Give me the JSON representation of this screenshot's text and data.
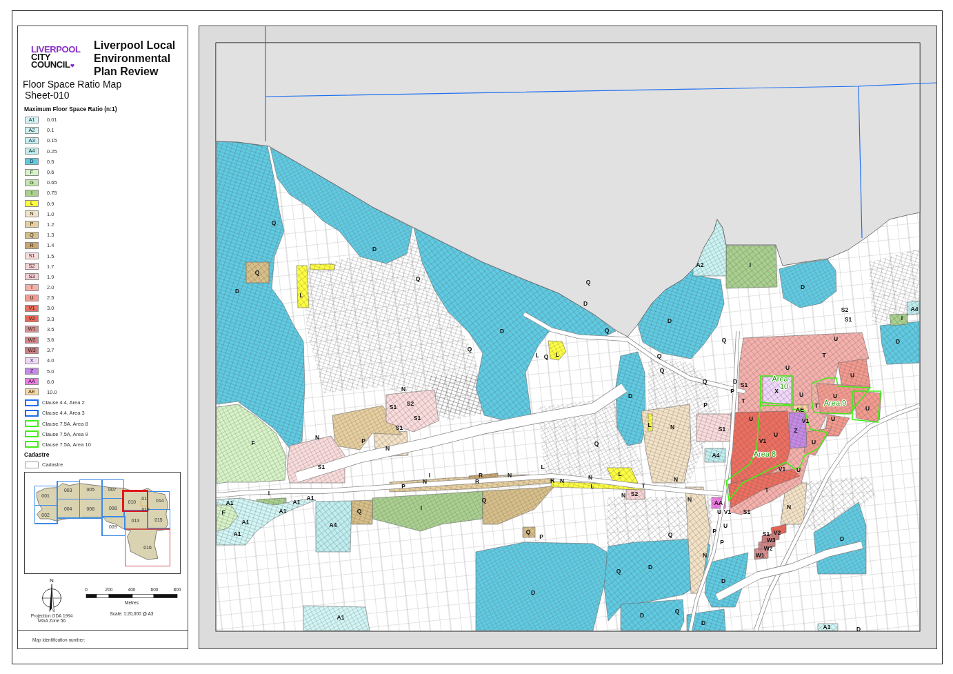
{
  "legend_panel": {
    "logo": {
      "lines": [
        "LIVERPOOL",
        "CITY",
        "COUNCIL"
      ]
    },
    "title": "Liverpool Local Environmental Plan Review",
    "map_title": "Floor Space Ratio Map",
    "sheet": "Sheet-010",
    "fsr_heading": "Maximum Floor Space Ratio (n:1)",
    "fsr_items": [
      {
        "kind": "fill",
        "code": "A1",
        "value": "0.01",
        "color": "#d2f6f6"
      },
      {
        "kind": "fill",
        "code": "A2",
        "value": "0.1",
        "color": "#cbf4f4"
      },
      {
        "kind": "fill",
        "code": "A3",
        "value": "0.15",
        "color": "#c5f1f2"
      },
      {
        "kind": "fill",
        "code": "A4",
        "value": "0.25",
        "color": "#bfeef0"
      },
      {
        "kind": "fill",
        "code": "D",
        "value": "0.5",
        "color": "#5fcbe3"
      },
      {
        "kind": "fill",
        "code": "F",
        "value": "0.6",
        "color": "#d6f4c6"
      },
      {
        "kind": "fill",
        "code": "G",
        "value": "0.65",
        "color": "#c2e6ad"
      },
      {
        "kind": "fill",
        "code": "I",
        "value": "0.75",
        "color": "#a9d08e"
      },
      {
        "kind": "fill",
        "code": "L",
        "value": "0.9",
        "color": "#ffff40"
      },
      {
        "kind": "fill",
        "code": "N",
        "value": "1.0",
        "color": "#f4e2c6"
      },
      {
        "kind": "fill",
        "code": "P",
        "value": "1.2",
        "color": "#e8cf9e"
      },
      {
        "kind": "fill",
        "code": "Q",
        "value": "1.3",
        "color": "#d8bf88"
      },
      {
        "kind": "fill",
        "code": "R",
        "value": "1.4",
        "color": "#caa56f"
      },
      {
        "kind": "fill",
        "code": "S1",
        "value": "1.5",
        "color": "#fbdcdd"
      },
      {
        "kind": "fill",
        "code": "S2",
        "value": "1.7",
        "color": "#f9d4d6"
      },
      {
        "kind": "fill",
        "code": "S3",
        "value": "1.9",
        "color": "#f6cdd0"
      },
      {
        "kind": "fill",
        "code": "T",
        "value": "2.0",
        "color": "#f6b1ad"
      },
      {
        "kind": "fill",
        "code": "U",
        "value": "2.5",
        "color": "#f49a8e"
      },
      {
        "kind": "fill",
        "code": "V1",
        "value": "3.0",
        "color": "#ee6e60"
      },
      {
        "kind": "fill",
        "code": "V2",
        "value": "3.3",
        "color": "#ec6556"
      },
      {
        "kind": "fill",
        "code": "W1",
        "value": "3.5",
        "color": "#d99090"
      },
      {
        "kind": "fill",
        "code": "W2",
        "value": "3.6",
        "color": "#d48787"
      },
      {
        "kind": "fill",
        "code": "W3",
        "value": "3.7",
        "color": "#cf7f80"
      },
      {
        "kind": "fill",
        "code": "X",
        "value": "4.0",
        "color": "#f0d7fa"
      },
      {
        "kind": "fill",
        "code": "Z",
        "value": "5.0",
        "color": "#c68ae6"
      },
      {
        "kind": "fill",
        "code": "AA",
        "value": "6.0",
        "color": "#f27de6"
      },
      {
        "kind": "fill",
        "code": "AE",
        "value": "10.0",
        "color": "#fbd9a1"
      },
      {
        "kind": "outline",
        "label": "Clause 4.4, Area 2",
        "color": "#1f6ff0"
      },
      {
        "kind": "outline",
        "label": "Clause 4.4, Area 3",
        "color": "#1e6ae8"
      },
      {
        "kind": "outline",
        "label": "Clause 7.5A, Area 8",
        "color": "#45ee1a"
      },
      {
        "kind": "outline",
        "label": "Clause 7.5A, Area 9",
        "color": "#44ec19"
      },
      {
        "kind": "outline",
        "label": "Clause 7.5A, Area 10",
        "color": "#43ea18"
      }
    ],
    "cadastre_heading": "Cadastre",
    "cadastre_items": [
      {
        "kind": "line",
        "label": "Cadastre",
        "color": "#9b9b9b"
      }
    ],
    "inset_map": {
      "tiles": [
        {
          "label": "001",
          "color": "#3d8ae6",
          "selected": false
        },
        {
          "label": "002",
          "color": "#3d8ae6",
          "selected": false
        },
        {
          "label": "003",
          "color": "#3d8ae6",
          "selected": false
        },
        {
          "label": "004",
          "color": "#3d8ae6",
          "selected": false
        },
        {
          "label": "005",
          "color": "#3d8ae6",
          "selected": false
        },
        {
          "label": "006",
          "color": "#3d8ae6",
          "selected": false
        },
        {
          "label": "007",
          "color": "#3d8ae6",
          "selected": false
        },
        {
          "label": "008",
          "color": "#3d8ae6",
          "selected": false
        },
        {
          "label": "009",
          "color": "#3d8ae6",
          "selected": false
        },
        {
          "label": "010",
          "color": "#e3161b",
          "selected": true
        },
        {
          "label": "013",
          "color": "#3d8ae6",
          "selected": false
        },
        {
          "label": "014",
          "color": "#3d8ae6",
          "selected": false
        },
        {
          "label": "015",
          "color": "#3d8ae6",
          "selected": false
        },
        {
          "label": "016",
          "color": "#c4514c",
          "selected": false
        }
      ],
      "labels": [
        "01",
        "012"
      ]
    },
    "north": "N",
    "projection": "Projection GDA 1994 MGA Zone 56",
    "scale": {
      "ticks": [
        "0",
        "200",
        "400",
        "600",
        "800"
      ],
      "unit": "Metres",
      "text": "Scale: 1:20,000 @ A3"
    },
    "footer": "Map identification number:"
  },
  "map": {
    "zone_labels": [
      "Q",
      "D",
      "A2",
      "I",
      "Q",
      "Q",
      "Q",
      "D",
      "D",
      "L",
      "D",
      "S2",
      "A4",
      "D",
      "S1",
      "I",
      "D",
      "Q",
      "Q",
      "U",
      "D",
      "Q",
      "L",
      "Q",
      "L",
      "Q",
      "T",
      "Q",
      "U",
      "U",
      "N",
      "Q",
      "D",
      "S1",
      "D",
      "P",
      "X",
      "U",
      "U",
      "S1",
      "S2",
      "P",
      "T",
      "AE",
      "T",
      "U",
      "S1",
      "U",
      "V1",
      "U",
      "S1",
      "L",
      "N",
      "S1",
      "Z",
      "F",
      "N",
      "P",
      "N",
      "Q",
      "V1",
      "U",
      "U",
      "A4",
      "S1",
      "L",
      "V1",
      "U",
      "I",
      "R",
      "N",
      "N",
      "L",
      "N",
      "R",
      "R",
      "N",
      "N",
      "I",
      "P",
      "L",
      "N",
      "S2",
      "T",
      "T",
      "A1",
      "A1",
      "A1",
      "Q",
      "N",
      "AA",
      "F",
      "A1",
      "Q",
      "I",
      "U",
      "V1",
      "S1",
      "N",
      "A1",
      "A4",
      "U",
      "A1",
      "Q",
      "P",
      "Q",
      "P",
      "S1",
      "V2",
      "P",
      "W3",
      "D",
      "W2",
      "N",
      "W1",
      "Q",
      "D",
      "D",
      "D",
      "A1",
      "D",
      "Q",
      "D",
      "A1",
      "D"
    ],
    "area_labels": [
      "Area 10",
      "Area 9",
      "Area 8"
    ]
  }
}
